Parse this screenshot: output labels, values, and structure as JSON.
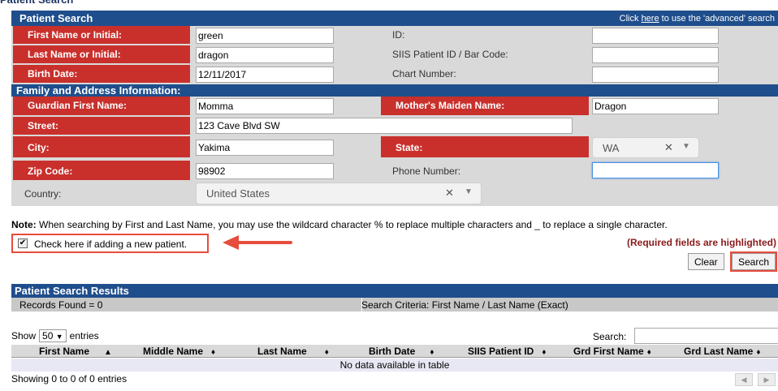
{
  "header": {
    "title": "Patient Search",
    "advanced_prefix": "Click ",
    "advanced_link": "here",
    "advanced_suffix": " to use the 'advanced' search"
  },
  "form": {
    "first_name_label": "First Name or Initial:",
    "first_name_value": "green",
    "id_label": "ID:",
    "id_value": "",
    "last_name_label": "Last Name or Initial:",
    "last_name_value": "dragon",
    "siis_label": "SIIS Patient ID / Bar Code:",
    "siis_value": "",
    "birth_label": "Birth Date:",
    "birth_value": "12/11/2017",
    "chart_label": "Chart Number:",
    "chart_value": ""
  },
  "family": {
    "section_title": "Family and Address Information:",
    "guardian_label": "Guardian First Name:",
    "guardian_value": "Momma",
    "maiden_label": "Mother's Maiden Name:",
    "maiden_value": "Dragon",
    "street_label": "Street:",
    "street_value": "123 Cave Blvd SW",
    "city_label": "City:",
    "city_value": "Yakima",
    "state_label": "State:",
    "state_value": "WA",
    "zip_label": "Zip Code:",
    "zip_value": "98902",
    "phone_label": "Phone Number:",
    "phone_value": "",
    "country_label": "Country:",
    "country_value": "United States"
  },
  "note": {
    "bold": "Note:",
    "text": " When searching by First and Last Name, you may use the wildcard character % to replace multiple characters and _ to replace a single character."
  },
  "new_patient_label": "Check here if adding a new patient.",
  "new_patient_checked": true,
  "required_text": "(Required fields are highlighted)",
  "buttons": {
    "clear": "Clear",
    "search": "Search"
  },
  "results": {
    "title": "Patient Search Results",
    "records_found": "Records Found = 0",
    "criteria": "Search Criteria: First Name / Last Name (Exact)",
    "show_label": "Show",
    "show_value": "50",
    "entries_label": "entries",
    "search_label": "Search:",
    "columns": [
      "First Name",
      "Middle Name",
      "Last Name",
      "Birth Date",
      "SIIS Patient ID",
      "Grd First Name",
      "Grd Last Name"
    ],
    "empty": "No data available in table",
    "showing": "Showing 0 to 0 of 0 entries"
  },
  "colors": {
    "header": "#1f4e8c",
    "required_label": "#c9302c",
    "highlight": "#e74c3c"
  },
  "icons": [
    "checkbox-checked-icon",
    "arrow-left-icon",
    "clear-x-icon",
    "chevron-down-icon",
    "sort-asc-icon",
    "sort-both-icon",
    "prev-page-icon",
    "next-page-icon"
  ]
}
